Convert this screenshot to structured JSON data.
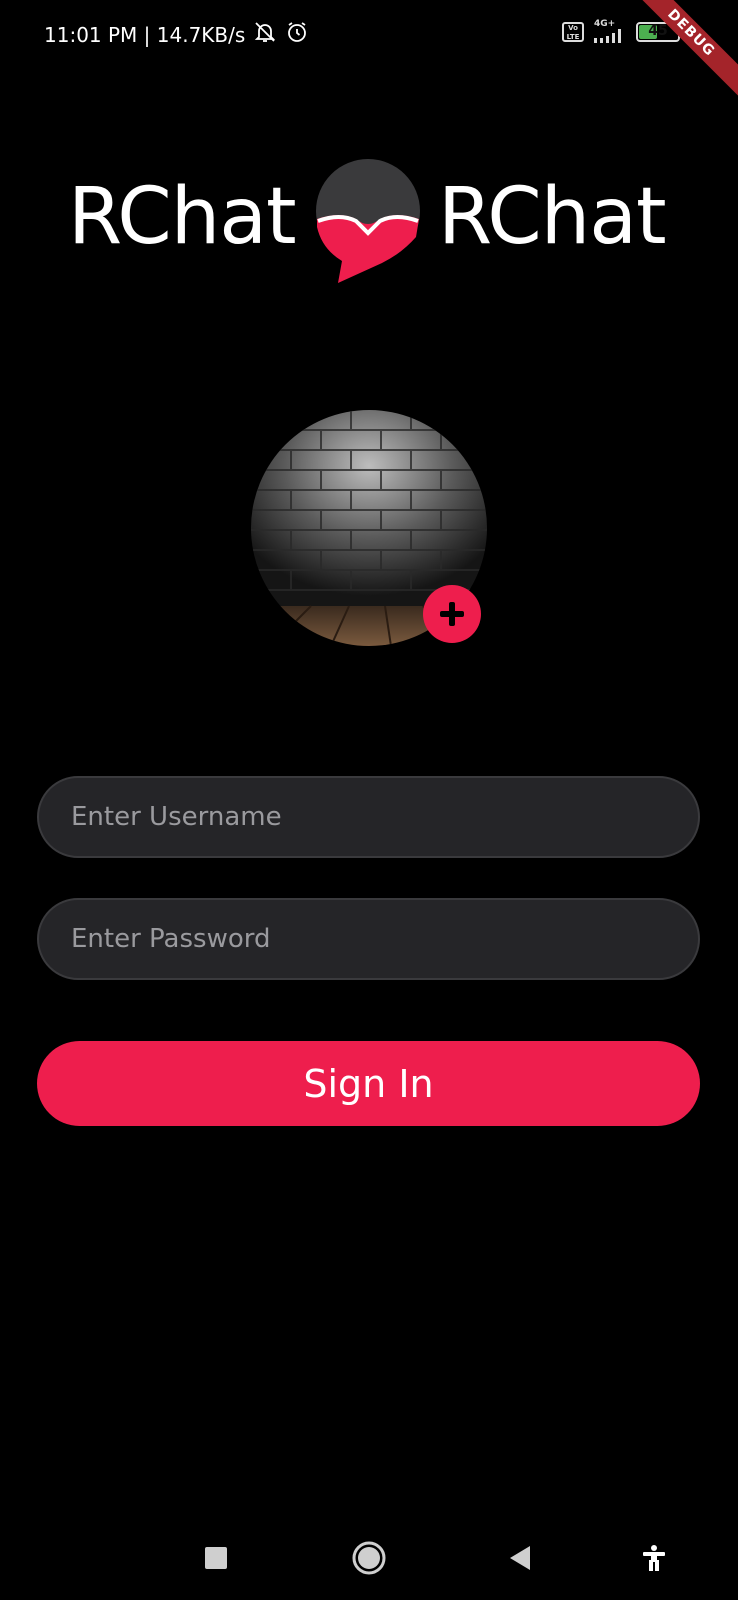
{
  "status_bar": {
    "time_speed": "11:01 PM | 14.7KB/s",
    "volte_label": "Vo LTE",
    "network_label": "4G+",
    "battery_level": "45",
    "battery_fraction": 0.45,
    "icons": [
      "bell-muted-icon",
      "alarm-icon",
      "volte-icon",
      "signal-icon",
      "battery-icon"
    ]
  },
  "debug_banner": {
    "label": "DEBUG",
    "color": "#a4242a"
  },
  "logo": {
    "left_text": "RChat",
    "right_text": "RChat"
  },
  "avatar": {
    "icon": "add-icon"
  },
  "form": {
    "username_placeholder": "Enter Username",
    "username_value": "",
    "password_placeholder": "Enter Password",
    "password_value": "",
    "sign_in_label": "Sign In"
  },
  "nav_bar": {
    "icons": [
      "recent-apps-icon",
      "home-icon",
      "back-icon",
      "accessibility-icon"
    ]
  },
  "colors": {
    "accent": "#ee1e4d",
    "background": "#000000",
    "field": "#252528"
  }
}
